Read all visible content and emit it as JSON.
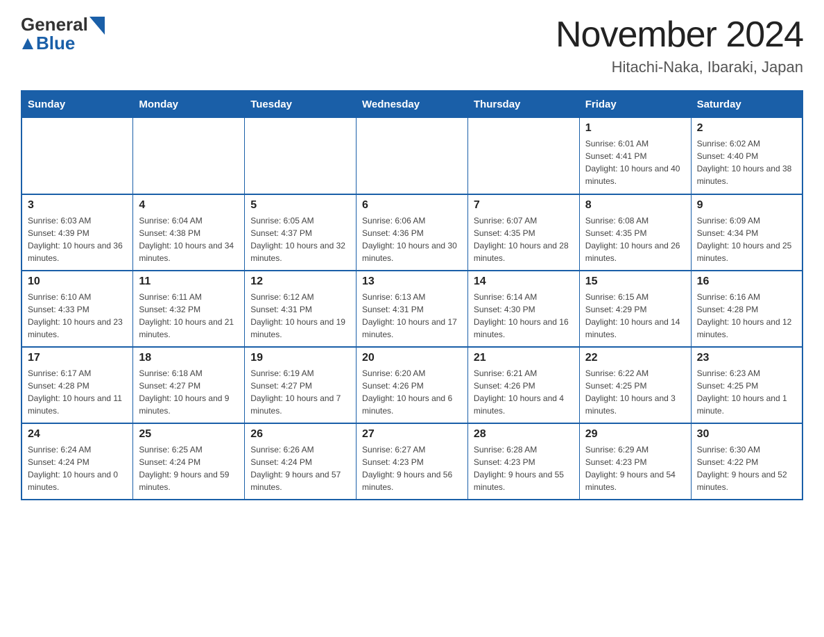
{
  "header": {
    "logo_general": "General",
    "logo_blue": "Blue",
    "month_title": "November 2024",
    "location": "Hitachi-Naka, Ibaraki, Japan"
  },
  "days_of_week": [
    "Sunday",
    "Monday",
    "Tuesday",
    "Wednesday",
    "Thursday",
    "Friday",
    "Saturday"
  ],
  "weeks": [
    [
      {
        "day": "",
        "sunrise": "",
        "sunset": "",
        "daylight": ""
      },
      {
        "day": "",
        "sunrise": "",
        "sunset": "",
        "daylight": ""
      },
      {
        "day": "",
        "sunrise": "",
        "sunset": "",
        "daylight": ""
      },
      {
        "day": "",
        "sunrise": "",
        "sunset": "",
        "daylight": ""
      },
      {
        "day": "",
        "sunrise": "",
        "sunset": "",
        "daylight": ""
      },
      {
        "day": "1",
        "sunrise": "Sunrise: 6:01 AM",
        "sunset": "Sunset: 4:41 PM",
        "daylight": "Daylight: 10 hours and 40 minutes."
      },
      {
        "day": "2",
        "sunrise": "Sunrise: 6:02 AM",
        "sunset": "Sunset: 4:40 PM",
        "daylight": "Daylight: 10 hours and 38 minutes."
      }
    ],
    [
      {
        "day": "3",
        "sunrise": "Sunrise: 6:03 AM",
        "sunset": "Sunset: 4:39 PM",
        "daylight": "Daylight: 10 hours and 36 minutes."
      },
      {
        "day": "4",
        "sunrise": "Sunrise: 6:04 AM",
        "sunset": "Sunset: 4:38 PM",
        "daylight": "Daylight: 10 hours and 34 minutes."
      },
      {
        "day": "5",
        "sunrise": "Sunrise: 6:05 AM",
        "sunset": "Sunset: 4:37 PM",
        "daylight": "Daylight: 10 hours and 32 minutes."
      },
      {
        "day": "6",
        "sunrise": "Sunrise: 6:06 AM",
        "sunset": "Sunset: 4:36 PM",
        "daylight": "Daylight: 10 hours and 30 minutes."
      },
      {
        "day": "7",
        "sunrise": "Sunrise: 6:07 AM",
        "sunset": "Sunset: 4:35 PM",
        "daylight": "Daylight: 10 hours and 28 minutes."
      },
      {
        "day": "8",
        "sunrise": "Sunrise: 6:08 AM",
        "sunset": "Sunset: 4:35 PM",
        "daylight": "Daylight: 10 hours and 26 minutes."
      },
      {
        "day": "9",
        "sunrise": "Sunrise: 6:09 AM",
        "sunset": "Sunset: 4:34 PM",
        "daylight": "Daylight: 10 hours and 25 minutes."
      }
    ],
    [
      {
        "day": "10",
        "sunrise": "Sunrise: 6:10 AM",
        "sunset": "Sunset: 4:33 PM",
        "daylight": "Daylight: 10 hours and 23 minutes."
      },
      {
        "day": "11",
        "sunrise": "Sunrise: 6:11 AM",
        "sunset": "Sunset: 4:32 PM",
        "daylight": "Daylight: 10 hours and 21 minutes."
      },
      {
        "day": "12",
        "sunrise": "Sunrise: 6:12 AM",
        "sunset": "Sunset: 4:31 PM",
        "daylight": "Daylight: 10 hours and 19 minutes."
      },
      {
        "day": "13",
        "sunrise": "Sunrise: 6:13 AM",
        "sunset": "Sunset: 4:31 PM",
        "daylight": "Daylight: 10 hours and 17 minutes."
      },
      {
        "day": "14",
        "sunrise": "Sunrise: 6:14 AM",
        "sunset": "Sunset: 4:30 PM",
        "daylight": "Daylight: 10 hours and 16 minutes."
      },
      {
        "day": "15",
        "sunrise": "Sunrise: 6:15 AM",
        "sunset": "Sunset: 4:29 PM",
        "daylight": "Daylight: 10 hours and 14 minutes."
      },
      {
        "day": "16",
        "sunrise": "Sunrise: 6:16 AM",
        "sunset": "Sunset: 4:28 PM",
        "daylight": "Daylight: 10 hours and 12 minutes."
      }
    ],
    [
      {
        "day": "17",
        "sunrise": "Sunrise: 6:17 AM",
        "sunset": "Sunset: 4:28 PM",
        "daylight": "Daylight: 10 hours and 11 minutes."
      },
      {
        "day": "18",
        "sunrise": "Sunrise: 6:18 AM",
        "sunset": "Sunset: 4:27 PM",
        "daylight": "Daylight: 10 hours and 9 minutes."
      },
      {
        "day": "19",
        "sunrise": "Sunrise: 6:19 AM",
        "sunset": "Sunset: 4:27 PM",
        "daylight": "Daylight: 10 hours and 7 minutes."
      },
      {
        "day": "20",
        "sunrise": "Sunrise: 6:20 AM",
        "sunset": "Sunset: 4:26 PM",
        "daylight": "Daylight: 10 hours and 6 minutes."
      },
      {
        "day": "21",
        "sunrise": "Sunrise: 6:21 AM",
        "sunset": "Sunset: 4:26 PM",
        "daylight": "Daylight: 10 hours and 4 minutes."
      },
      {
        "day": "22",
        "sunrise": "Sunrise: 6:22 AM",
        "sunset": "Sunset: 4:25 PM",
        "daylight": "Daylight: 10 hours and 3 minutes."
      },
      {
        "day": "23",
        "sunrise": "Sunrise: 6:23 AM",
        "sunset": "Sunset: 4:25 PM",
        "daylight": "Daylight: 10 hours and 1 minute."
      }
    ],
    [
      {
        "day": "24",
        "sunrise": "Sunrise: 6:24 AM",
        "sunset": "Sunset: 4:24 PM",
        "daylight": "Daylight: 10 hours and 0 minutes."
      },
      {
        "day": "25",
        "sunrise": "Sunrise: 6:25 AM",
        "sunset": "Sunset: 4:24 PM",
        "daylight": "Daylight: 9 hours and 59 minutes."
      },
      {
        "day": "26",
        "sunrise": "Sunrise: 6:26 AM",
        "sunset": "Sunset: 4:24 PM",
        "daylight": "Daylight: 9 hours and 57 minutes."
      },
      {
        "day": "27",
        "sunrise": "Sunrise: 6:27 AM",
        "sunset": "Sunset: 4:23 PM",
        "daylight": "Daylight: 9 hours and 56 minutes."
      },
      {
        "day": "28",
        "sunrise": "Sunrise: 6:28 AM",
        "sunset": "Sunset: 4:23 PM",
        "daylight": "Daylight: 9 hours and 55 minutes."
      },
      {
        "day": "29",
        "sunrise": "Sunrise: 6:29 AM",
        "sunset": "Sunset: 4:23 PM",
        "daylight": "Daylight: 9 hours and 54 minutes."
      },
      {
        "day": "30",
        "sunrise": "Sunrise: 6:30 AM",
        "sunset": "Sunset: 4:22 PM",
        "daylight": "Daylight: 9 hours and 52 minutes."
      }
    ]
  ]
}
